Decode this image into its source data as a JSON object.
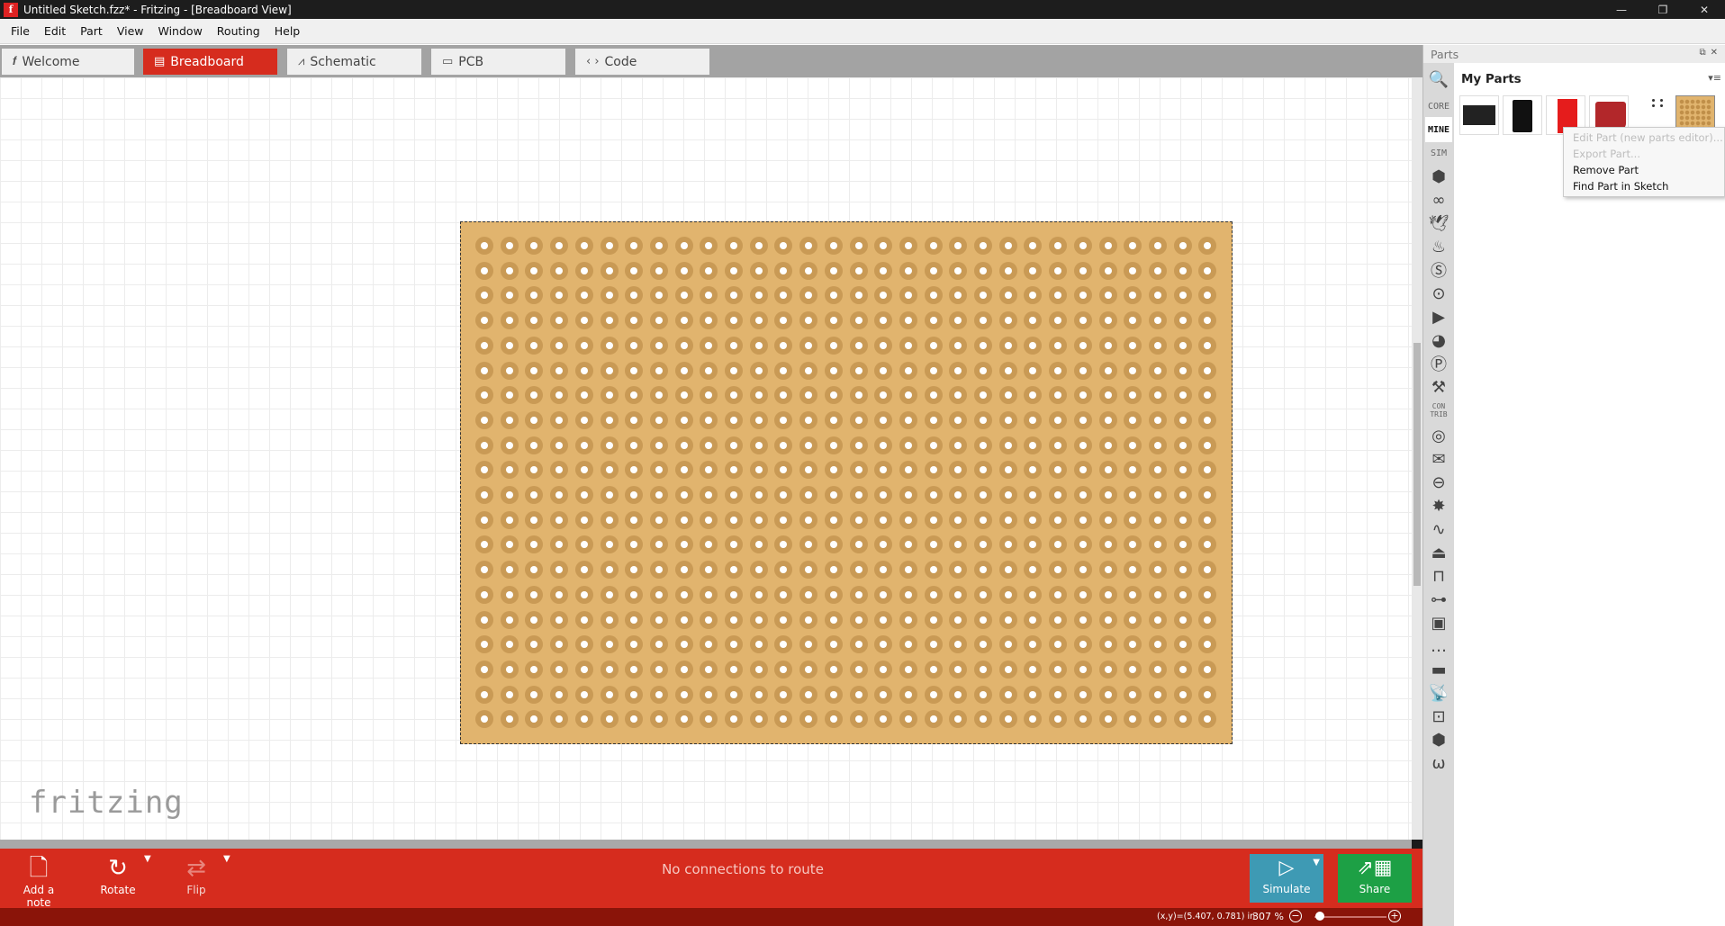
{
  "window": {
    "app_icon": "f",
    "title": "Untitled Sketch.fzz* - Fritzing - [Breadboard View]",
    "minimize": "—",
    "maximize": "❐",
    "close": "✕"
  },
  "menu": [
    "File",
    "Edit",
    "Part",
    "View",
    "Window",
    "Routing",
    "Help"
  ],
  "tabs": [
    {
      "label": "Welcome",
      "icon": "𝒇"
    },
    {
      "label": "Breadboard",
      "icon": "▤"
    },
    {
      "label": "Schematic",
      "icon": "⩘"
    },
    {
      "label": "PCB",
      "icon": "▭"
    },
    {
      "label": "Code",
      "icon": "‹ ›"
    }
  ],
  "active_tab": "Breadboard",
  "board": {
    "rows": 20,
    "cols": 30,
    "color": "#e1b46e"
  },
  "watermark": "fritzing",
  "toolbar": {
    "add_note": "Add a note",
    "rotate": "Rotate",
    "flip": "Flip",
    "status": "No connections to route",
    "simulate": "Simulate",
    "share": "Share"
  },
  "statusbar": {
    "coords": "(x,y)=(5.407, 0.781) in",
    "zoom": "307 %",
    "zoom_minus": "−",
    "zoom_plus": "+"
  },
  "parts": {
    "header": "Parts",
    "bin_title": "My Parts",
    "bins": [
      "CORE",
      "MINE",
      "SIM"
    ],
    "contrib": "CON\nTRIB",
    "context_menu": [
      {
        "label": "Edit Part (new parts editor)...",
        "enabled": false
      },
      {
        "label": "Export Part...",
        "enabled": false
      },
      {
        "label": "Remove Part",
        "enabled": true
      },
      {
        "label": "Find Part in Sketch",
        "enabled": true
      }
    ]
  }
}
